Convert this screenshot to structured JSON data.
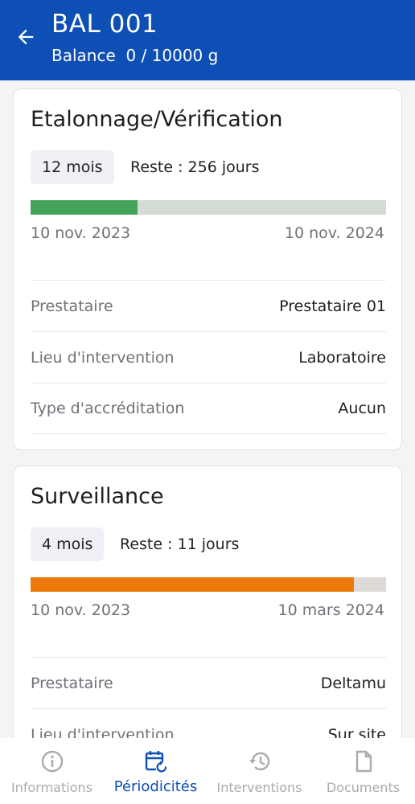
{
  "header": {
    "title": "BAL 001",
    "subtitle": "Balance  0 / 10000 g"
  },
  "cards": [
    {
      "title": "Etalonnage/Vérification",
      "period": "12 mois",
      "remaining": "Reste : 256 jours",
      "progress": 0.3,
      "progress_color": "#43a35a",
      "track_color": "#d3dbd5",
      "start_date": "10 nov. 2023",
      "end_date": "10 nov. 2024",
      "rows": [
        {
          "label": "Prestataire",
          "value": "Prestataire 01"
        },
        {
          "label": "Lieu d'intervention",
          "value": "Laboratoire"
        },
        {
          "label": "Type d'accréditation",
          "value": "Aucun"
        }
      ]
    },
    {
      "title": "Surveillance",
      "period": "4 mois",
      "remaining": "Reste : 11 jours",
      "progress": 0.91,
      "progress_color": "#ec7a0a",
      "track_color": "#dedad7",
      "start_date": "10 nov. 2023",
      "end_date": "10 mars 2024",
      "rows": [
        {
          "label": "Prestataire",
          "value": "Deltamu"
        },
        {
          "label": "Lieu d'intervention",
          "value": "Sur site"
        }
      ]
    }
  ],
  "nav": [
    {
      "label": "Informations",
      "icon": "info-icon",
      "active": false
    },
    {
      "label": "Périodicités",
      "icon": "calendar-refresh-icon",
      "active": true
    },
    {
      "label": "Interventions",
      "icon": "history-icon",
      "active": false
    },
    {
      "label": "Documents",
      "icon": "document-icon",
      "active": false
    }
  ],
  "colors": {
    "primary": "#0d4fb4",
    "inactive": "#a9abb0"
  }
}
